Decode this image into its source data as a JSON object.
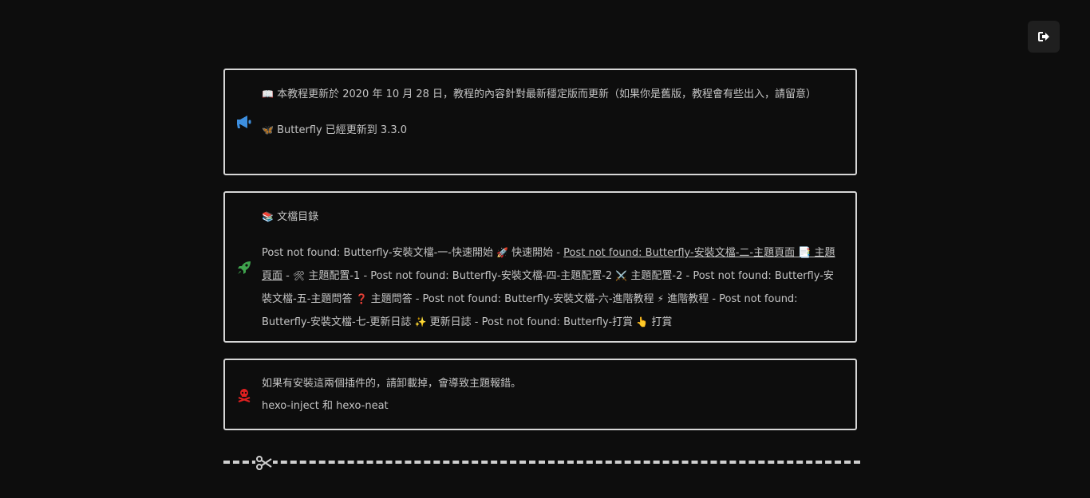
{
  "exit_button": {
    "icon": "sign-out-icon"
  },
  "notes": [
    {
      "icon": "bullhorn-icon",
      "icon_color": "#3d8fe0",
      "line1_emoji": "📖",
      "line1": "本教程更新於 2020 年 10 月 28 日，教程的內容針對最新穩定版而更新（如果你是舊版，教程會有些出入，請留意）",
      "line2_emoji": "🦋",
      "line2": "Butterfly 已經更新到 3.3.0"
    },
    {
      "icon": "rocket-icon",
      "icon_color": "#3fa34d",
      "title_emoji": "📚",
      "title": "文檔目錄",
      "toc": {
        "s1": "Post not found: Butterfly-安裝文檔-一-快速開始 ",
        "e1": "🚀",
        "s2": " 快速開始 - ",
        "link": "Post not found: Butterfly-安裝文檔-二-主題頁面 📑 主題頁面",
        "s3": " - ",
        "e3": "🛠",
        "s4": " 主題配置-1 - Post not found: Butterfly-安裝文檔-四-主題配置-2 ",
        "e4": "⚔️",
        "s5": " 主題配置-2 - Post not found: Butterfly-安裝文檔-五-主題問答 ",
        "e5": "❓",
        "s6": " 主題問答 - Post not found: Butterfly-安裝文檔-六-進階教程 ",
        "e6": "⚡",
        "s7": " 進階教程 - Post not found: Butterfly-安裝文檔-七-更新日誌 ",
        "e7": "✨",
        "s8": " 更新日誌 - Post not found: Butterfly-打賞 ",
        "e8": "👆",
        "s9": " 打賞"
      }
    },
    {
      "icon": "skull-crossbones-icon",
      "icon_color": "#e02020",
      "line1": "如果有安裝這兩個插件的，請卸載掉，會導致主題報錯。",
      "line2": "hexo-inject 和 hexo-neat"
    }
  ],
  "divider": {
    "icon": "scissors-icon"
  }
}
